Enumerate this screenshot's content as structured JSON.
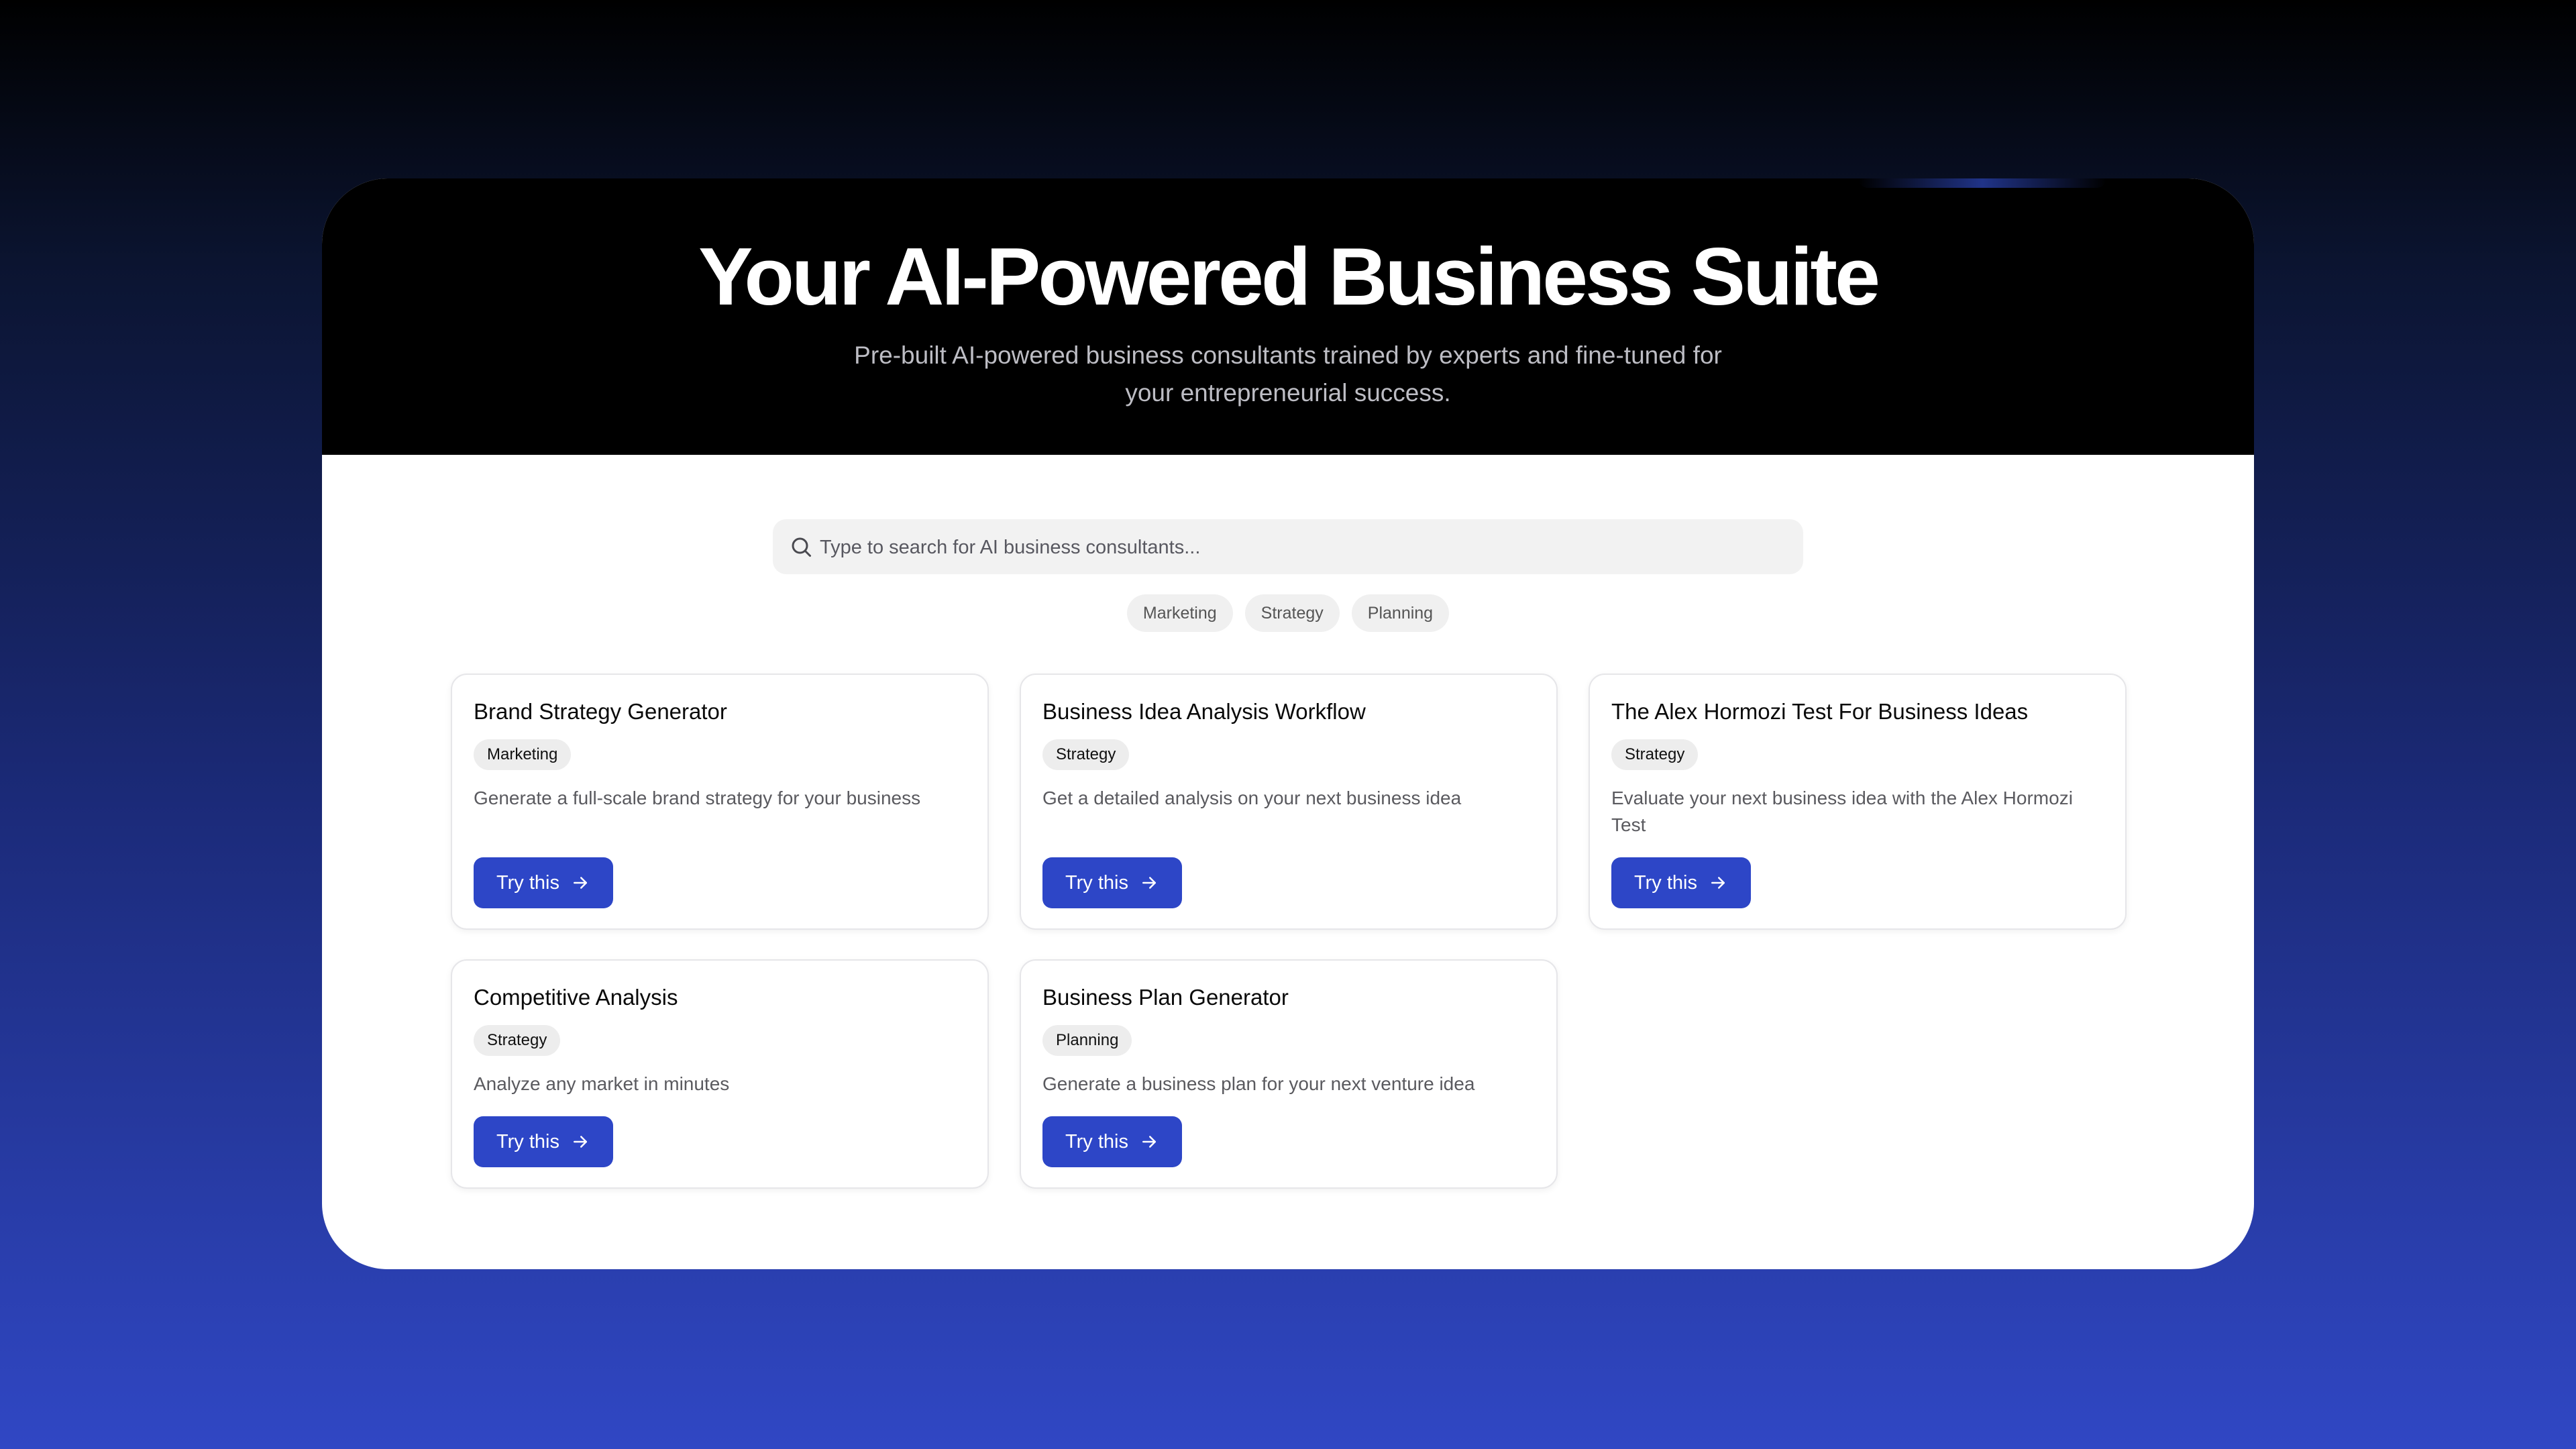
{
  "hero": {
    "title": "Your AI-Powered Business Suite",
    "subtitle": "Pre-built AI-powered business consultants trained by experts and fine-tuned for your entrepreneurial success."
  },
  "search": {
    "placeholder": "Type to search for AI business consultants...",
    "value": "",
    "icon": "search-icon"
  },
  "filters": [
    "Marketing",
    "Strategy",
    "Planning"
  ],
  "cards": [
    {
      "title": "Brand Strategy Generator",
      "tag": "Marketing",
      "description": "Generate a full-scale brand strategy for your business",
      "button_label": "Try this"
    },
    {
      "title": "Business Idea Analysis Workflow",
      "tag": "Strategy",
      "description": "Get a detailed analysis on your next business idea",
      "button_label": "Try this"
    },
    {
      "title": "The Alex Hormozi Test For Business Ideas",
      "tag": "Strategy",
      "description": "Evaluate your next business idea with the Alex Hormozi Test",
      "button_label": "Try this"
    },
    {
      "title": "Competitive Analysis",
      "tag": "Strategy",
      "description": "Analyze any market in minutes",
      "button_label": "Try this"
    },
    {
      "title": "Business Plan Generator",
      "tag": "Planning",
      "description": "Generate a business plan for your next venture idea",
      "button_label": "Try this"
    }
  ],
  "colors": {
    "accent": "#2d46c7",
    "hero_background": "#000000",
    "card_border": "#e6e6e9",
    "chip_background": "#f0f0f0"
  },
  "icons": {
    "button_arrow": "arrow-right-icon"
  }
}
